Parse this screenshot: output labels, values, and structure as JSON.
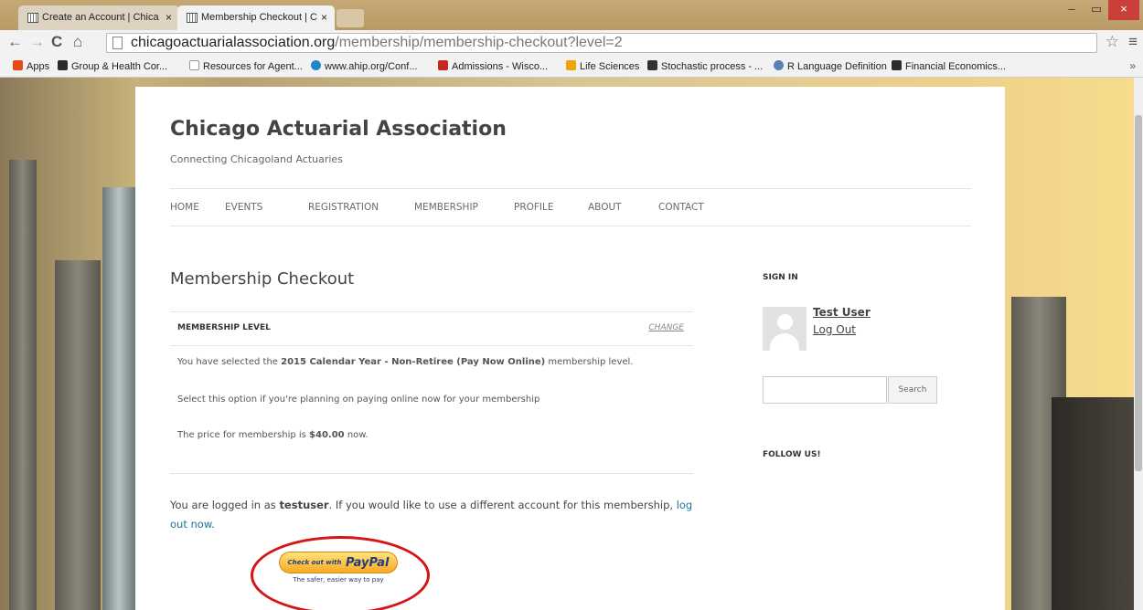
{
  "browser": {
    "tabs": [
      {
        "title": "Create an Account | Chica"
      },
      {
        "title": "Membership Checkout | C"
      }
    ],
    "tab_close": "×",
    "window_controls": [
      "–",
      "▭",
      "×"
    ],
    "nav_icons": {
      "back": "←",
      "forward": "→",
      "reload": "C",
      "home": "⌂"
    },
    "url_host": "chicagoactuarialassociation.org",
    "url_path": "/membership/membership-checkout?level=2",
    "star_icon": "☆",
    "menu_icon": "≡",
    "bookmarks": [
      {
        "label": "Apps",
        "color": "#e64a19"
      },
      {
        "label": "Group & Health Cor...",
        "color": "#2b2b2b"
      },
      {
        "label": "Resources for Agent...",
        "color": "#bbbbbb"
      },
      {
        "label": "www.ahip.org/Conf...",
        "color": "#1e88c7"
      },
      {
        "label": "Admissions - Wisco...",
        "color": "#c5281c"
      },
      {
        "label": "Life Sciences",
        "color": "#f0a30a"
      },
      {
        "label": "Stochastic process - ...",
        "color": "#333333"
      },
      {
        "label": "R Language Definition",
        "color": "#5a7fb5"
      },
      {
        "label": "Financial Economics...",
        "color": "#2b2b2b"
      }
    ],
    "bookmarks_overflow": "»"
  },
  "site": {
    "title": "Chicago Actuarial Association",
    "tagline": "Connecting Chicagoland Actuaries",
    "nav": [
      "HOME",
      "EVENTS",
      "REGISTRATION",
      "MEMBERSHIP",
      "PROFILE",
      "ABOUT",
      "CONTACT"
    ]
  },
  "checkout": {
    "title": "Membership Checkout",
    "level_header": "MEMBERSHIP LEVEL",
    "change_label": "CHANGE",
    "selected_prefix": "You have selected the ",
    "selected_level": "2015 Calendar Year - Non-Retiree (Pay Now Online)",
    "selected_suffix": " membership level.",
    "option_note": "Select this option if you're planning on paying online now for your membership",
    "price_prefix": "The price for membership is ",
    "price": "$40.00",
    "price_suffix": " now.",
    "logged_prefix": "You are logged in as ",
    "username": "testuser",
    "logged_middle": ". If you would like to use a different account for this membership, ",
    "logout_link": "log out now",
    "logged_end": "."
  },
  "paypal": {
    "line1": "Check out with",
    "brand": "PayPal",
    "tagline": "The safer, easier way to pay",
    "highlight_color": "#d41616"
  },
  "sidebar": {
    "signin_title": "SIGN IN",
    "user_name": "Test User",
    "logout_label": "Log Out",
    "search_button": "Search",
    "follow_title": "FOLLOW US!"
  }
}
